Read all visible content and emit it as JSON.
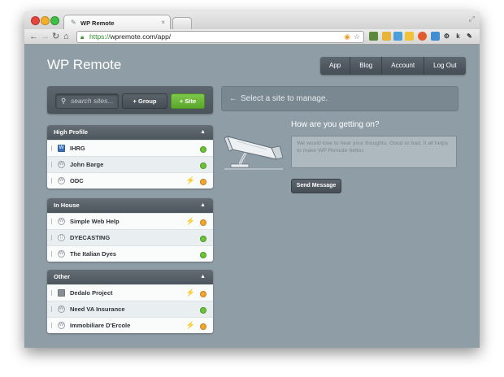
{
  "browser": {
    "tab_title": "WP Remote",
    "tab_favicon": "✎",
    "tab_close": "×",
    "url_https": "https://",
    "url_rest": "wpremote.com/app/"
  },
  "app": {
    "title": "WP Remote",
    "nav": [
      "App",
      "Blog",
      "Account",
      "Log Out"
    ]
  },
  "search": {
    "placeholder": "search sites...",
    "group_button": "+ Group",
    "site_button": "+ Site"
  },
  "groups": [
    {
      "name": "High Profile",
      "sites": [
        {
          "name": "IHRG",
          "icon": "ihrg-logo-icon",
          "plugin_update": false,
          "status": "green"
        },
        {
          "name": "John Barge",
          "icon": "wordpress-icon",
          "plugin_update": false,
          "status": "green"
        },
        {
          "name": "ODC",
          "icon": "wordpress-icon",
          "plugin_update": true,
          "status": "orange"
        }
      ]
    },
    {
      "name": "In House",
      "sites": [
        {
          "name": "Simple Web Help",
          "icon": "wordpress-icon",
          "plugin_update": true,
          "status": "orange"
        },
        {
          "name": "DYECASTING",
          "icon": "dyecasting-logo-icon",
          "plugin_update": false,
          "status": "green"
        },
        {
          "name": "The Italian Dyes",
          "icon": "wordpress-icon",
          "plugin_update": false,
          "status": "green"
        }
      ]
    },
    {
      "name": "Other",
      "sites": [
        {
          "name": "Dedalo Project",
          "icon": "dedalo-logo-icon",
          "plugin_update": true,
          "status": "orange"
        },
        {
          "name": "Need VA Insurance",
          "icon": "wordpress-icon",
          "plugin_update": false,
          "status": "green"
        },
        {
          "name": "Immobiliare D'Ercole",
          "icon": "wordpress-icon",
          "plugin_update": true,
          "status": "orange"
        }
      ]
    }
  ],
  "main": {
    "select_arrow": "←",
    "select_message": "Select a site to manage.",
    "feedback_title": "How are you getting on?",
    "feedback_placeholder": "We would love to hear your thoughts. Good or bad. It all helps to make WP Remote better.",
    "send_label": "Send Message"
  },
  "colors": {
    "status_green": "#6ec13b",
    "status_orange": "#f0a630",
    "accent_green": "#5aa72c",
    "background": "#8f9da6"
  }
}
